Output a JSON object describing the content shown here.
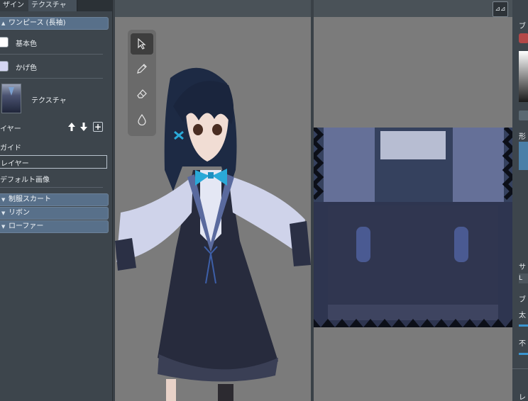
{
  "tabs": [
    {
      "label": "ザイン"
    },
    {
      "label": "テクスチャ"
    }
  ],
  "sections": {
    "onepiece": "ワンピース (長袖)",
    "skirt": "制服スカート",
    "ribbon": "リボン",
    "loafer": "ローファー"
  },
  "onepiece": {
    "base_color_label": "基本色",
    "base_color": "#ffffff",
    "shade_color_label": "かげ色",
    "shade_color": "#d4d6f2",
    "texture_label": "テクスチャ",
    "layer_label": "イヤー",
    "layer_up": "🡡",
    "layer_down": "🡣",
    "layer_add": "+",
    "layers": [
      "ガイド",
      "レイヤー",
      "デフォルト画像"
    ],
    "selected_layer": "レイヤー"
  },
  "tools": {
    "icons": [
      "cursor-icon",
      "pen-icon",
      "eraser-icon",
      "fill-icon"
    ],
    "selected": "cursor-icon"
  },
  "mirror_button": "⊿⊿",
  "right_panel": {
    "labels": [
      "ブ",
      "形",
      "サ",
      "L",
      "ブ",
      "太",
      "不",
      "レ"
    ],
    "accent_color": "#b34848"
  },
  "colors": {
    "panel_bg": "#3d454c",
    "section_header": "#58708a",
    "viewport_bg": "#7b7b7b"
  }
}
